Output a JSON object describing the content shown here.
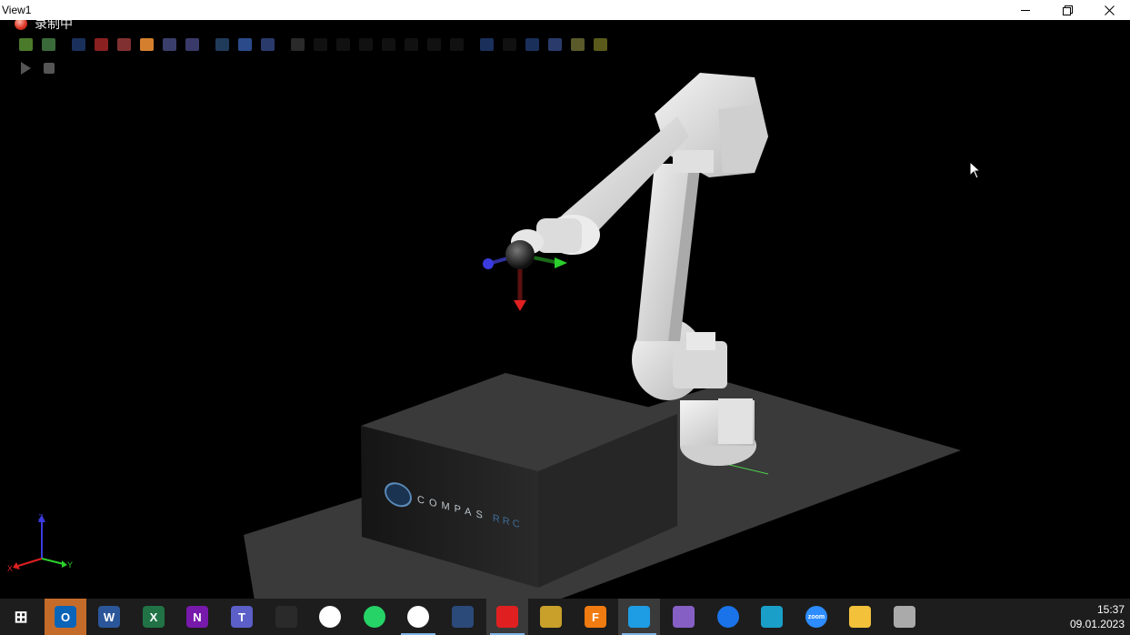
{
  "window": {
    "title": "View1",
    "controls": [
      "minimize-icon",
      "restore-icon",
      "close-icon"
    ]
  },
  "viewport": {
    "recording_label": "录制中",
    "toolbar_row1": [
      {
        "name": "solid-view-icon",
        "color": "#4a7a2a"
      },
      {
        "name": "wire-view-icon",
        "color": "#3a6a3a"
      },
      {
        "name": "separator"
      },
      {
        "name": "frame-icon",
        "color": "#1a2f5a"
      },
      {
        "name": "red-cube-icon",
        "color": "#8a2020"
      },
      {
        "name": "color-cube-icon",
        "color": "#803030"
      },
      {
        "name": "highlighted-object-icon",
        "color": "#d47f2e"
      },
      {
        "name": "object-group-icon",
        "color": "#3a3f6a"
      },
      {
        "name": "link-icon",
        "color": "#3a3a6a"
      },
      {
        "name": "separator"
      },
      {
        "name": "axis-icon",
        "color": "#203a5a"
      },
      {
        "name": "ruler-icon",
        "color": "#2a4a8a"
      },
      {
        "name": "transform-icon",
        "color": "#2a3a6a"
      },
      {
        "name": "separator"
      },
      {
        "name": "grid-dots-icon",
        "color": "#2a2a2a"
      },
      {
        "name": "dot-icon",
        "color": "#111"
      },
      {
        "name": "dot-pair-icon",
        "color": "#111"
      },
      {
        "name": "dot-corner-icon",
        "color": "#111"
      },
      {
        "name": "dot-small-icon",
        "color": "#111"
      },
      {
        "name": "arrow-left-icon",
        "color": "#111"
      },
      {
        "name": "dot-low-icon",
        "color": "#111"
      },
      {
        "name": "dot-tiny-icon",
        "color": "#111"
      },
      {
        "name": "separator"
      },
      {
        "name": "path-icon",
        "color": "#1a2f5a"
      },
      {
        "name": "path-alt-icon",
        "color": "#111"
      },
      {
        "name": "path-blue-icon",
        "color": "#1a2f5a"
      },
      {
        "name": "connect-icon",
        "color": "#2a3a6a"
      },
      {
        "name": "layers-icon",
        "color": "#5a5a2a"
      },
      {
        "name": "layer-single-icon",
        "color": "#5a5a1a"
      }
    ],
    "toolbar_row2": [
      {
        "name": "play-icon",
        "color": "#555"
      },
      {
        "name": "stop-icon",
        "color": "#555"
      }
    ],
    "block_logo_text": "COMPAS",
    "block_logo_suffix": "RRC",
    "axis_labels": {
      "x": "X",
      "y": "Y",
      "z": "Z"
    }
  },
  "taskbar": {
    "apps": [
      {
        "name": "start-icon",
        "label": "",
        "color": "#1d1d1d",
        "glyph": "⊞"
      },
      {
        "name": "outlook-icon",
        "label": "O",
        "color": "#0a64b8",
        "highlight": true
      },
      {
        "name": "word-icon",
        "label": "W",
        "color": "#2b579a"
      },
      {
        "name": "excel-icon",
        "label": "X",
        "color": "#217346"
      },
      {
        "name": "onenote-icon",
        "label": "N",
        "color": "#7719aa"
      },
      {
        "name": "teams-icon",
        "label": "T",
        "color": "#5b5fc7"
      },
      {
        "name": "chat-app-icon",
        "label": "",
        "color": "#2a2a2a"
      },
      {
        "name": "slack-icon",
        "label": "",
        "color": "#fff"
      },
      {
        "name": "whatsapp-icon",
        "label": "",
        "color": "#25d366"
      },
      {
        "name": "chrome-icon",
        "label": "",
        "color": "#fff",
        "active": true
      },
      {
        "name": "app-hex-icon",
        "label": "",
        "color": "#2b4a7a"
      },
      {
        "name": "recorder-icon",
        "label": "",
        "color": "#e02020",
        "active": true,
        "highlightbg": true
      },
      {
        "name": "robot-studio-icon",
        "label": "",
        "color": "#c8a02a"
      },
      {
        "name": "fusion360-icon",
        "label": "F",
        "color": "#f07b10"
      },
      {
        "name": "vscode-icon",
        "label": "",
        "color": "#1e9de5",
        "active": true,
        "highlightbg": true
      },
      {
        "name": "visual-studio-icon",
        "label": "",
        "color": "#865fc5"
      },
      {
        "name": "maps-pin-icon",
        "label": "",
        "color": "#1a73e8"
      },
      {
        "name": "monitor-app-icon",
        "label": "",
        "color": "#1aa0c8"
      },
      {
        "name": "zoom-icon",
        "label": "zoom",
        "color": "#2d8cff"
      },
      {
        "name": "file-explorer-icon",
        "label": "",
        "color": "#f3c13a"
      },
      {
        "name": "remote-desktop-icon",
        "label": "",
        "color": "#aaa"
      }
    ],
    "clock": {
      "time": "15:37",
      "date": "09.01.2023"
    }
  }
}
